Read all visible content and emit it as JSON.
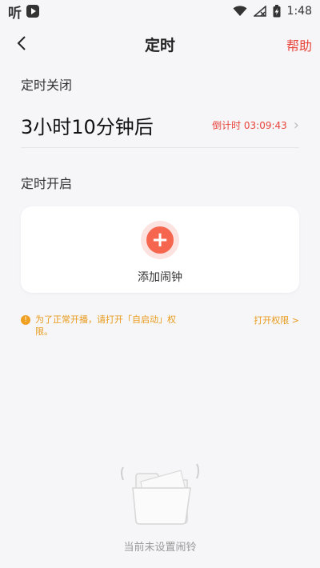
{
  "status_bar": {
    "app_glyph": "听",
    "time": "1:48"
  },
  "header": {
    "title": "定时",
    "help": "帮助"
  },
  "timer_close": {
    "label": "定时关闭",
    "value": "3小时10分钟后",
    "countdown": "倒计时 03:09:43"
  },
  "timer_open": {
    "label": "定时开启",
    "add_button_label": "添加闹钟"
  },
  "notice": {
    "text": "为了正常开播，请打开「自启动」权限。",
    "link": "打开权限 >"
  },
  "empty_state": {
    "text": "当前未设置闹铃"
  },
  "colors": {
    "accent": "#e8453c",
    "add_button": "#f6664f",
    "warning": "#e89a1a"
  }
}
